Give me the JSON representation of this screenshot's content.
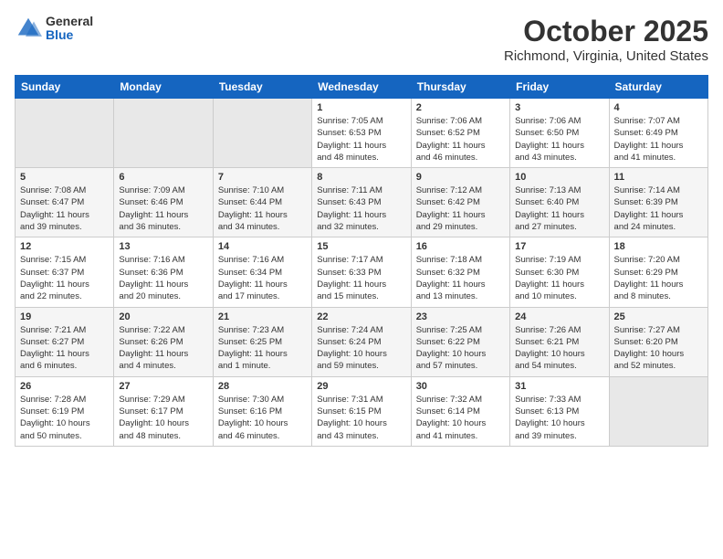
{
  "logo": {
    "general": "General",
    "blue": "Blue"
  },
  "title": "October 2025",
  "location": "Richmond, Virginia, United States",
  "days_of_week": [
    "Sunday",
    "Monday",
    "Tuesday",
    "Wednesday",
    "Thursday",
    "Friday",
    "Saturday"
  ],
  "weeks": [
    [
      {
        "day": "",
        "info": ""
      },
      {
        "day": "",
        "info": ""
      },
      {
        "day": "",
        "info": ""
      },
      {
        "day": "1",
        "info": "Sunrise: 7:05 AM\nSunset: 6:53 PM\nDaylight: 11 hours\nand 48 minutes."
      },
      {
        "day": "2",
        "info": "Sunrise: 7:06 AM\nSunset: 6:52 PM\nDaylight: 11 hours\nand 46 minutes."
      },
      {
        "day": "3",
        "info": "Sunrise: 7:06 AM\nSunset: 6:50 PM\nDaylight: 11 hours\nand 43 minutes."
      },
      {
        "day": "4",
        "info": "Sunrise: 7:07 AM\nSunset: 6:49 PM\nDaylight: 11 hours\nand 41 minutes."
      }
    ],
    [
      {
        "day": "5",
        "info": "Sunrise: 7:08 AM\nSunset: 6:47 PM\nDaylight: 11 hours\nand 39 minutes."
      },
      {
        "day": "6",
        "info": "Sunrise: 7:09 AM\nSunset: 6:46 PM\nDaylight: 11 hours\nand 36 minutes."
      },
      {
        "day": "7",
        "info": "Sunrise: 7:10 AM\nSunset: 6:44 PM\nDaylight: 11 hours\nand 34 minutes."
      },
      {
        "day": "8",
        "info": "Sunrise: 7:11 AM\nSunset: 6:43 PM\nDaylight: 11 hours\nand 32 minutes."
      },
      {
        "day": "9",
        "info": "Sunrise: 7:12 AM\nSunset: 6:42 PM\nDaylight: 11 hours\nand 29 minutes."
      },
      {
        "day": "10",
        "info": "Sunrise: 7:13 AM\nSunset: 6:40 PM\nDaylight: 11 hours\nand 27 minutes."
      },
      {
        "day": "11",
        "info": "Sunrise: 7:14 AM\nSunset: 6:39 PM\nDaylight: 11 hours\nand 24 minutes."
      }
    ],
    [
      {
        "day": "12",
        "info": "Sunrise: 7:15 AM\nSunset: 6:37 PM\nDaylight: 11 hours\nand 22 minutes."
      },
      {
        "day": "13",
        "info": "Sunrise: 7:16 AM\nSunset: 6:36 PM\nDaylight: 11 hours\nand 20 minutes."
      },
      {
        "day": "14",
        "info": "Sunrise: 7:16 AM\nSunset: 6:34 PM\nDaylight: 11 hours\nand 17 minutes."
      },
      {
        "day": "15",
        "info": "Sunrise: 7:17 AM\nSunset: 6:33 PM\nDaylight: 11 hours\nand 15 minutes."
      },
      {
        "day": "16",
        "info": "Sunrise: 7:18 AM\nSunset: 6:32 PM\nDaylight: 11 hours\nand 13 minutes."
      },
      {
        "day": "17",
        "info": "Sunrise: 7:19 AM\nSunset: 6:30 PM\nDaylight: 11 hours\nand 10 minutes."
      },
      {
        "day": "18",
        "info": "Sunrise: 7:20 AM\nSunset: 6:29 PM\nDaylight: 11 hours\nand 8 minutes."
      }
    ],
    [
      {
        "day": "19",
        "info": "Sunrise: 7:21 AM\nSunset: 6:27 PM\nDaylight: 11 hours\nand 6 minutes."
      },
      {
        "day": "20",
        "info": "Sunrise: 7:22 AM\nSunset: 6:26 PM\nDaylight: 11 hours\nand 4 minutes."
      },
      {
        "day": "21",
        "info": "Sunrise: 7:23 AM\nSunset: 6:25 PM\nDaylight: 11 hours\nand 1 minute."
      },
      {
        "day": "22",
        "info": "Sunrise: 7:24 AM\nSunset: 6:24 PM\nDaylight: 10 hours\nand 59 minutes."
      },
      {
        "day": "23",
        "info": "Sunrise: 7:25 AM\nSunset: 6:22 PM\nDaylight: 10 hours\nand 57 minutes."
      },
      {
        "day": "24",
        "info": "Sunrise: 7:26 AM\nSunset: 6:21 PM\nDaylight: 10 hours\nand 54 minutes."
      },
      {
        "day": "25",
        "info": "Sunrise: 7:27 AM\nSunset: 6:20 PM\nDaylight: 10 hours\nand 52 minutes."
      }
    ],
    [
      {
        "day": "26",
        "info": "Sunrise: 7:28 AM\nSunset: 6:19 PM\nDaylight: 10 hours\nand 50 minutes."
      },
      {
        "day": "27",
        "info": "Sunrise: 7:29 AM\nSunset: 6:17 PM\nDaylight: 10 hours\nand 48 minutes."
      },
      {
        "day": "28",
        "info": "Sunrise: 7:30 AM\nSunset: 6:16 PM\nDaylight: 10 hours\nand 46 minutes."
      },
      {
        "day": "29",
        "info": "Sunrise: 7:31 AM\nSunset: 6:15 PM\nDaylight: 10 hours\nand 43 minutes."
      },
      {
        "day": "30",
        "info": "Sunrise: 7:32 AM\nSunset: 6:14 PM\nDaylight: 10 hours\nand 41 minutes."
      },
      {
        "day": "31",
        "info": "Sunrise: 7:33 AM\nSunset: 6:13 PM\nDaylight: 10 hours\nand 39 minutes."
      },
      {
        "day": "",
        "info": ""
      }
    ]
  ]
}
